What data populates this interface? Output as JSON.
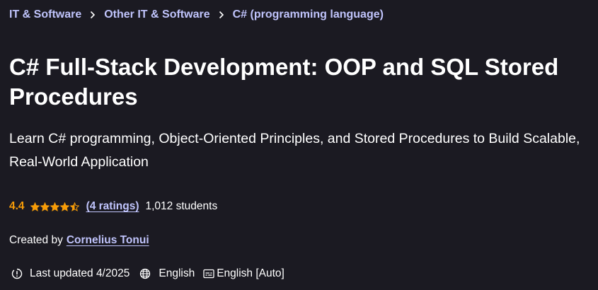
{
  "breadcrumb": {
    "items": [
      "IT & Software",
      "Other IT & Software",
      "C# (programming language)"
    ]
  },
  "course": {
    "title": "C# Full-Stack Development: OOP and SQL Stored Procedures",
    "subtitle": "Learn C# programming, Object-Oriented Principles, and Stored Procedures to Build Scalable, Real-World Application"
  },
  "rating": {
    "value": "4.4",
    "stars": 4.5,
    "ratings_link": "(4 ratings)",
    "students": "1,012 students"
  },
  "instructor": {
    "label": "Created by",
    "name": "Cornelius Tonui"
  },
  "meta": {
    "last_updated": "Last updated 4/2025",
    "language": "English",
    "captions": "English [Auto]"
  },
  "icons": {
    "separator": "chevron-right-icon",
    "star": "star-icon",
    "last_updated": "alert-clock-icon",
    "language": "globe-icon",
    "captions": "closed-captions-icon"
  },
  "colors": {
    "background": "#1b1a22",
    "text": "#ffffff",
    "link": "#c0c4fc",
    "rating": "#f69c08"
  }
}
